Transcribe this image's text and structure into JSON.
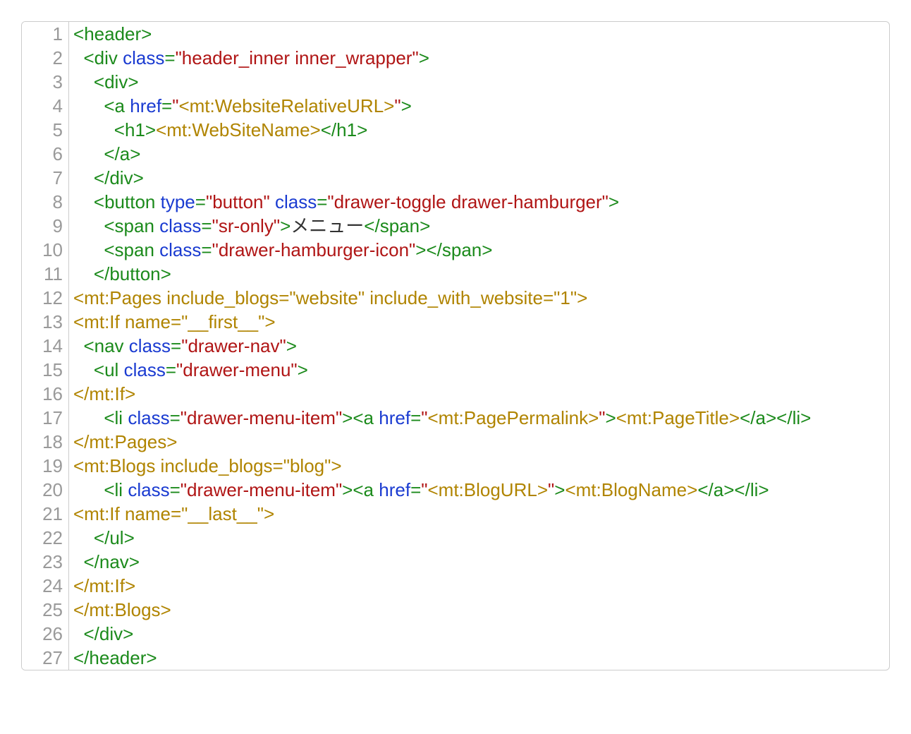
{
  "code": {
    "lines": [
      {
        "n": "1",
        "tokens": [
          {
            "t": "<",
            "c": "punct"
          },
          {
            "t": "header",
            "c": "tagname"
          },
          {
            "t": ">",
            "c": "punct"
          }
        ]
      },
      {
        "n": "2",
        "tokens": [
          {
            "t": "  ",
            "c": "text"
          },
          {
            "t": "<",
            "c": "punct"
          },
          {
            "t": "div",
            "c": "tagname"
          },
          {
            "t": " ",
            "c": "text"
          },
          {
            "t": "class",
            "c": "attr"
          },
          {
            "t": "=",
            "c": "punct"
          },
          {
            "t": "\"header_inner inner_wrapper\"",
            "c": "string"
          },
          {
            "t": ">",
            "c": "punct"
          }
        ]
      },
      {
        "n": "3",
        "tokens": [
          {
            "t": "    ",
            "c": "text"
          },
          {
            "t": "<",
            "c": "punct"
          },
          {
            "t": "div",
            "c": "tagname"
          },
          {
            "t": ">",
            "c": "punct"
          }
        ]
      },
      {
        "n": "4",
        "tokens": [
          {
            "t": "      ",
            "c": "text"
          },
          {
            "t": "<",
            "c": "punct"
          },
          {
            "t": "a",
            "c": "tagname"
          },
          {
            "t": " ",
            "c": "text"
          },
          {
            "t": "href",
            "c": "attr"
          },
          {
            "t": "=",
            "c": "punct"
          },
          {
            "t": "\"",
            "c": "string"
          },
          {
            "t": "<mt:WebsiteRelativeURL>",
            "c": "mt"
          },
          {
            "t": "\"",
            "c": "string"
          },
          {
            "t": ">",
            "c": "punct"
          }
        ]
      },
      {
        "n": "5",
        "tokens": [
          {
            "t": "        ",
            "c": "text"
          },
          {
            "t": "<",
            "c": "punct"
          },
          {
            "t": "h1",
            "c": "tagname"
          },
          {
            "t": ">",
            "c": "punct"
          },
          {
            "t": "<mt:WebSiteName>",
            "c": "mt"
          },
          {
            "t": "</",
            "c": "punct"
          },
          {
            "t": "h1",
            "c": "tagname"
          },
          {
            "t": ">",
            "c": "punct"
          }
        ]
      },
      {
        "n": "6",
        "tokens": [
          {
            "t": "      ",
            "c": "text"
          },
          {
            "t": "</",
            "c": "punct"
          },
          {
            "t": "a",
            "c": "tagname"
          },
          {
            "t": ">",
            "c": "punct"
          }
        ]
      },
      {
        "n": "7",
        "tokens": [
          {
            "t": "    ",
            "c": "text"
          },
          {
            "t": "</",
            "c": "punct"
          },
          {
            "t": "div",
            "c": "tagname"
          },
          {
            "t": ">",
            "c": "punct"
          }
        ]
      },
      {
        "n": "8",
        "tokens": [
          {
            "t": "    ",
            "c": "text"
          },
          {
            "t": "<",
            "c": "punct"
          },
          {
            "t": "button",
            "c": "tagname"
          },
          {
            "t": " ",
            "c": "text"
          },
          {
            "t": "type",
            "c": "attr"
          },
          {
            "t": "=",
            "c": "punct"
          },
          {
            "t": "\"button\"",
            "c": "string"
          },
          {
            "t": " ",
            "c": "text"
          },
          {
            "t": "class",
            "c": "attr"
          },
          {
            "t": "=",
            "c": "punct"
          },
          {
            "t": "\"drawer-toggle drawer-hamburger\"",
            "c": "string"
          },
          {
            "t": ">",
            "c": "punct"
          }
        ]
      },
      {
        "n": "9",
        "tokens": [
          {
            "t": "      ",
            "c": "text"
          },
          {
            "t": "<",
            "c": "punct"
          },
          {
            "t": "span",
            "c": "tagname"
          },
          {
            "t": " ",
            "c": "text"
          },
          {
            "t": "class",
            "c": "attr"
          },
          {
            "t": "=",
            "c": "punct"
          },
          {
            "t": "\"sr-only\"",
            "c": "string"
          },
          {
            "t": ">",
            "c": "punct"
          },
          {
            "t": "メニュー",
            "c": "text"
          },
          {
            "t": "</",
            "c": "punct"
          },
          {
            "t": "span",
            "c": "tagname"
          },
          {
            "t": ">",
            "c": "punct"
          }
        ]
      },
      {
        "n": "10",
        "tokens": [
          {
            "t": "      ",
            "c": "text"
          },
          {
            "t": "<",
            "c": "punct"
          },
          {
            "t": "span",
            "c": "tagname"
          },
          {
            "t": " ",
            "c": "text"
          },
          {
            "t": "class",
            "c": "attr"
          },
          {
            "t": "=",
            "c": "punct"
          },
          {
            "t": "\"drawer-hamburger-icon\"",
            "c": "string"
          },
          {
            "t": ">",
            "c": "punct"
          },
          {
            "t": "</",
            "c": "punct"
          },
          {
            "t": "span",
            "c": "tagname"
          },
          {
            "t": ">",
            "c": "punct"
          }
        ]
      },
      {
        "n": "11",
        "tokens": [
          {
            "t": "    ",
            "c": "text"
          },
          {
            "t": "</",
            "c": "punct"
          },
          {
            "t": "button",
            "c": "tagname"
          },
          {
            "t": ">",
            "c": "punct"
          }
        ]
      },
      {
        "n": "12",
        "tokens": [
          {
            "t": "<mt:Pages include_blogs=\"website\" include_with_website=\"1\">",
            "c": "mt"
          }
        ]
      },
      {
        "n": "13",
        "tokens": [
          {
            "t": "<mt:If name=\"__first__\">",
            "c": "mt"
          }
        ]
      },
      {
        "n": "14",
        "tokens": [
          {
            "t": "  ",
            "c": "text"
          },
          {
            "t": "<",
            "c": "punct"
          },
          {
            "t": "nav",
            "c": "tagname"
          },
          {
            "t": " ",
            "c": "text"
          },
          {
            "t": "class",
            "c": "attr"
          },
          {
            "t": "=",
            "c": "punct"
          },
          {
            "t": "\"drawer-nav\"",
            "c": "string"
          },
          {
            "t": ">",
            "c": "punct"
          }
        ]
      },
      {
        "n": "15",
        "tokens": [
          {
            "t": "    ",
            "c": "text"
          },
          {
            "t": "<",
            "c": "punct"
          },
          {
            "t": "ul",
            "c": "tagname"
          },
          {
            "t": " ",
            "c": "text"
          },
          {
            "t": "class",
            "c": "attr"
          },
          {
            "t": "=",
            "c": "punct"
          },
          {
            "t": "\"drawer-menu\"",
            "c": "string"
          },
          {
            "t": ">",
            "c": "punct"
          }
        ]
      },
      {
        "n": "16",
        "tokens": [
          {
            "t": "</mt:If>",
            "c": "mt"
          }
        ]
      },
      {
        "n": "17",
        "tokens": [
          {
            "t": "      ",
            "c": "text"
          },
          {
            "t": "<",
            "c": "punct"
          },
          {
            "t": "li",
            "c": "tagname"
          },
          {
            "t": " ",
            "c": "text"
          },
          {
            "t": "class",
            "c": "attr"
          },
          {
            "t": "=",
            "c": "punct"
          },
          {
            "t": "\"drawer-menu-item\"",
            "c": "string"
          },
          {
            "t": ">",
            "c": "punct"
          },
          {
            "t": "<",
            "c": "punct"
          },
          {
            "t": "a",
            "c": "tagname"
          },
          {
            "t": " ",
            "c": "text"
          },
          {
            "t": "href",
            "c": "attr"
          },
          {
            "t": "=",
            "c": "punct"
          },
          {
            "t": "\"",
            "c": "string"
          },
          {
            "t": "<mt:PagePermalink>",
            "c": "mt"
          },
          {
            "t": "\"",
            "c": "string"
          },
          {
            "t": ">",
            "c": "punct"
          },
          {
            "t": "<mt:PageTitle>",
            "c": "mt"
          },
          {
            "t": "</",
            "c": "punct"
          },
          {
            "t": "a",
            "c": "tagname"
          },
          {
            "t": ">",
            "c": "punct"
          },
          {
            "t": "</",
            "c": "punct"
          },
          {
            "t": "li",
            "c": "tagname"
          },
          {
            "t": ">",
            "c": "punct"
          }
        ]
      },
      {
        "n": "18",
        "tokens": [
          {
            "t": "</mt:Pages>",
            "c": "mt"
          }
        ]
      },
      {
        "n": "19",
        "tokens": [
          {
            "t": "<mt:Blogs include_blogs=\"blog\">",
            "c": "mt"
          }
        ]
      },
      {
        "n": "20",
        "tokens": [
          {
            "t": "      ",
            "c": "text"
          },
          {
            "t": "<",
            "c": "punct"
          },
          {
            "t": "li",
            "c": "tagname"
          },
          {
            "t": " ",
            "c": "text"
          },
          {
            "t": "class",
            "c": "attr"
          },
          {
            "t": "=",
            "c": "punct"
          },
          {
            "t": "\"drawer-menu-item\"",
            "c": "string"
          },
          {
            "t": ">",
            "c": "punct"
          },
          {
            "t": "<",
            "c": "punct"
          },
          {
            "t": "a",
            "c": "tagname"
          },
          {
            "t": " ",
            "c": "text"
          },
          {
            "t": "href",
            "c": "attr"
          },
          {
            "t": "=",
            "c": "punct"
          },
          {
            "t": "\"",
            "c": "string"
          },
          {
            "t": "<mt:BlogURL>",
            "c": "mt"
          },
          {
            "t": "\"",
            "c": "string"
          },
          {
            "t": ">",
            "c": "punct"
          },
          {
            "t": "<mt:BlogName>",
            "c": "mt"
          },
          {
            "t": "</",
            "c": "punct"
          },
          {
            "t": "a",
            "c": "tagname"
          },
          {
            "t": ">",
            "c": "punct"
          },
          {
            "t": "</",
            "c": "punct"
          },
          {
            "t": "li",
            "c": "tagname"
          },
          {
            "t": ">",
            "c": "punct"
          }
        ]
      },
      {
        "n": "21",
        "tokens": [
          {
            "t": "<mt:If name=\"__last__\">",
            "c": "mt"
          }
        ]
      },
      {
        "n": "22",
        "tokens": [
          {
            "t": "    ",
            "c": "text"
          },
          {
            "t": "</",
            "c": "punct"
          },
          {
            "t": "ul",
            "c": "tagname"
          },
          {
            "t": ">",
            "c": "punct"
          }
        ]
      },
      {
        "n": "23",
        "tokens": [
          {
            "t": "  ",
            "c": "text"
          },
          {
            "t": "</",
            "c": "punct"
          },
          {
            "t": "nav",
            "c": "tagname"
          },
          {
            "t": ">",
            "c": "punct"
          }
        ]
      },
      {
        "n": "24",
        "tokens": [
          {
            "t": "</mt:If>",
            "c": "mt"
          }
        ]
      },
      {
        "n": "25",
        "tokens": [
          {
            "t": "</mt:Blogs>",
            "c": "mt"
          }
        ]
      },
      {
        "n": "26",
        "tokens": [
          {
            "t": "  ",
            "c": "text"
          },
          {
            "t": "</",
            "c": "punct"
          },
          {
            "t": "div",
            "c": "tagname"
          },
          {
            "t": ">",
            "c": "punct"
          }
        ]
      },
      {
        "n": "27",
        "tokens": [
          {
            "t": "</",
            "c": "punct"
          },
          {
            "t": "header",
            "c": "tagname"
          },
          {
            "t": ">",
            "c": "punct"
          }
        ]
      }
    ]
  }
}
